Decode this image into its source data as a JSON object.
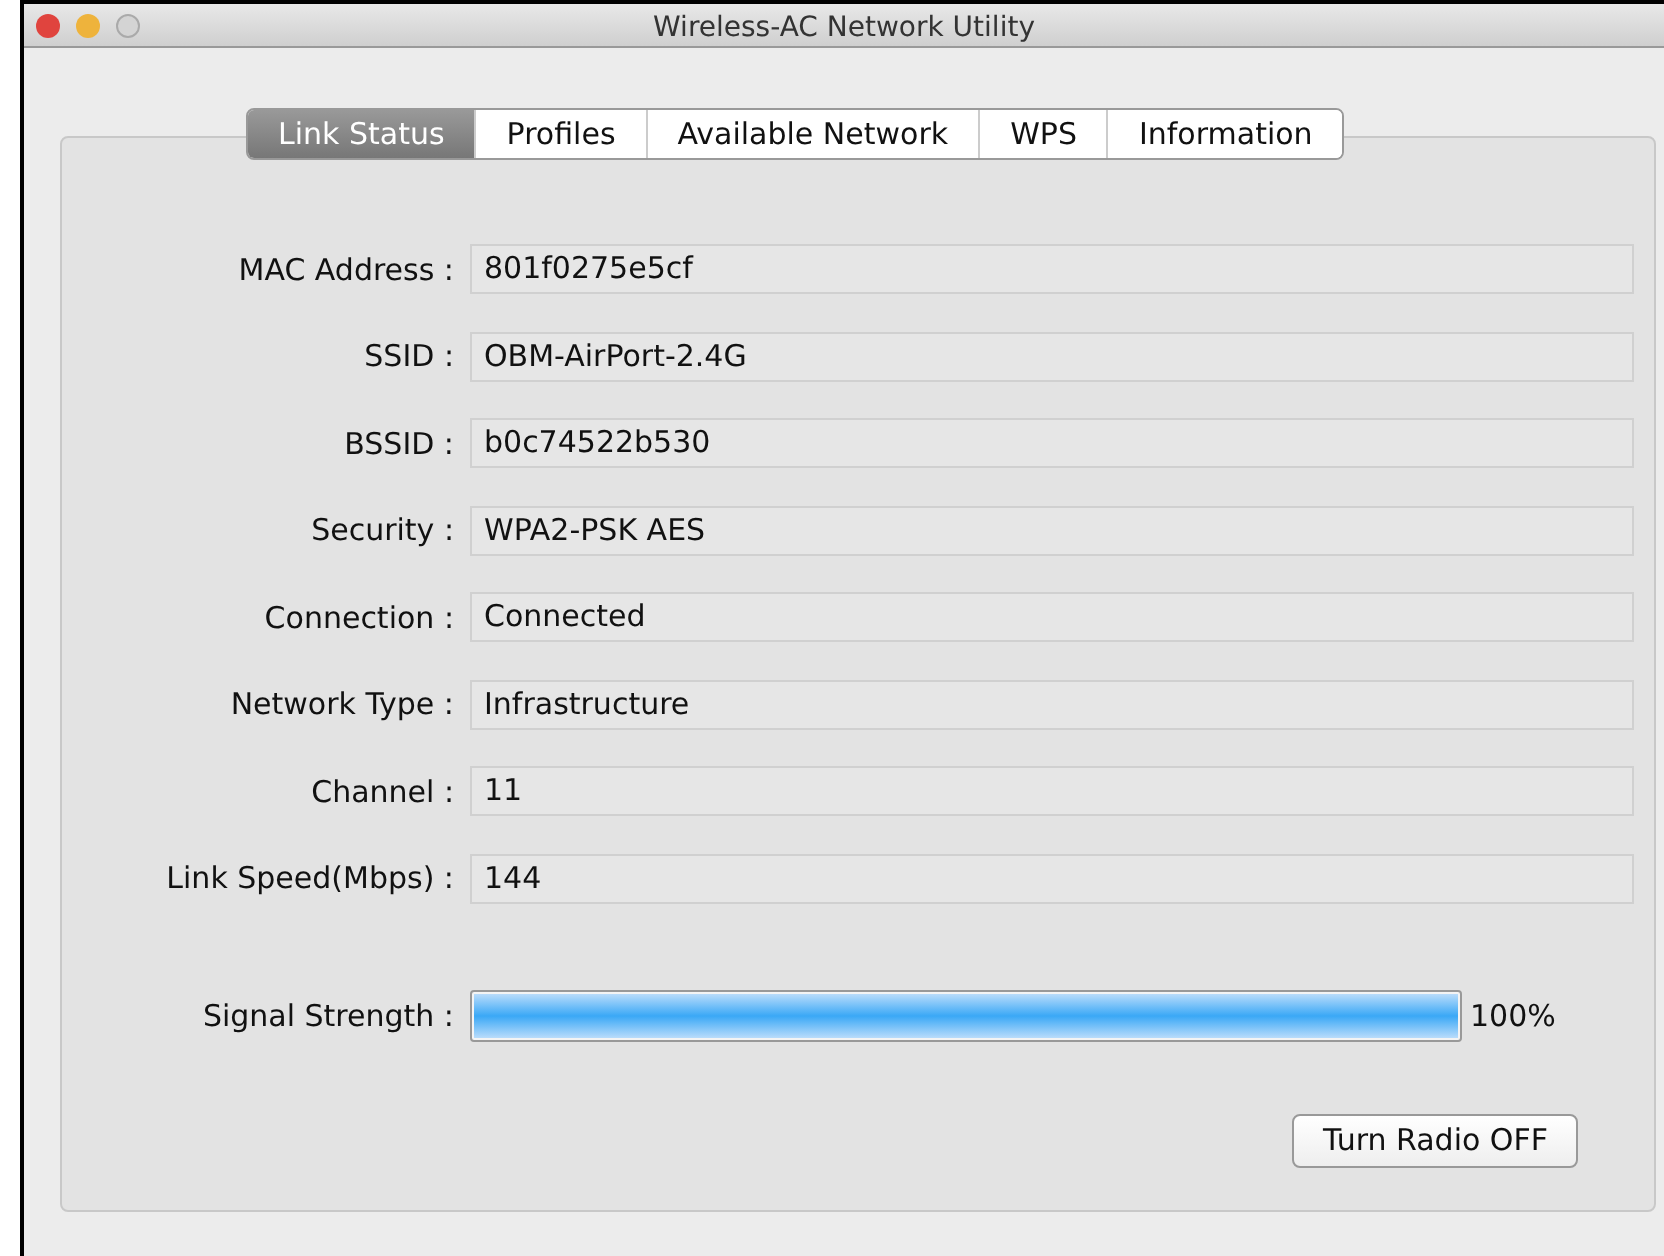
{
  "window": {
    "title": "Wireless-AC Network Utility"
  },
  "tabs": [
    {
      "label": "Link Status",
      "selected": true
    },
    {
      "label": "Profiles",
      "selected": false
    },
    {
      "label": "Available Network",
      "selected": false
    },
    {
      "label": "WPS",
      "selected": false
    },
    {
      "label": "Information",
      "selected": false
    }
  ],
  "fields": [
    {
      "label": "MAC Address :",
      "value": "801f0275e5cf"
    },
    {
      "label": "SSID :",
      "value": "OBM-AirPort-2.4G"
    },
    {
      "label": "BSSID :",
      "value": "b0c74522b530"
    },
    {
      "label": "Security :",
      "value": "WPA2-PSK AES"
    },
    {
      "label": "Connection :",
      "value": "Connected"
    },
    {
      "label": "Network Type :",
      "value": "Infrastructure"
    },
    {
      "label": "Channel :",
      "value": "11"
    },
    {
      "label": "Link Speed(Mbps) :",
      "value": "144"
    }
  ],
  "signal": {
    "label": "Signal Strength :",
    "level": 1.0,
    "reading": "100%"
  },
  "buttons": [
    "Turn Radio OFF"
  ]
}
